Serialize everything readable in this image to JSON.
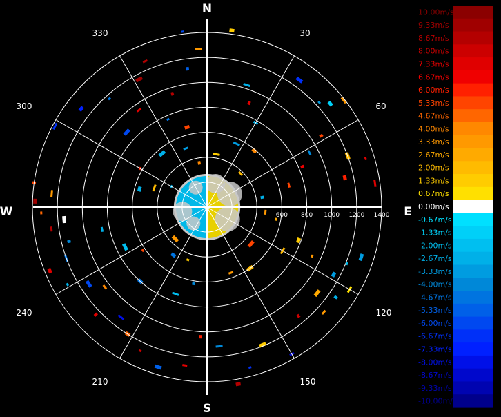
{
  "chart_data": {
    "type": "polar-ppi",
    "title": "",
    "compass_labels": [
      "N",
      "E",
      "S",
      "W"
    ],
    "bearing_labels": [
      "30",
      "60",
      "120",
      "150",
      "210",
      "240",
      "300",
      "330"
    ],
    "range_labels": [
      "600",
      "800",
      "1000",
      "1200",
      "1400"
    ],
    "range_max": 1400,
    "range_rings": [
      200,
      400,
      600,
      800,
      1000,
      1200,
      1400
    ],
    "spoke_angles_deg": [
      0,
      30,
      60,
      90,
      120,
      150,
      180,
      210,
      240,
      270,
      300,
      330
    ],
    "colorbar": {
      "unit": "m/s",
      "labels": [
        "10.00m/s",
        "9.33m/s",
        "8.67m/s",
        "8.00m/s",
        "7.33m/s",
        "6.67m/s",
        "6.00m/s",
        "5.33m/s",
        "4.67m/s",
        "4.00m/s",
        "3.33m/s",
        "2.67m/s",
        "2.00m/s",
        "1.33m/s",
        "0.67m/s",
        "0.00m/s",
        "-0.67m/s",
        "-1.33m/s",
        "-2.00m/s",
        "-2.67m/s",
        "-3.33m/s",
        "-4.00m/s",
        "-4.67m/s",
        "-5.33m/s",
        "-6.00m/s",
        "-6.67m/s",
        "-7.33m/s",
        "-8.00m/s",
        "-8.67m/s",
        "-9.33m/s",
        "-10.00m/s"
      ],
      "colors": [
        "#8b0000",
        "#a00000",
        "#b40000",
        "#cc0000",
        "#e00000",
        "#f00000",
        "#ff2000",
        "#ff4400",
        "#ff6600",
        "#ff8800",
        "#ff9900",
        "#ffaa00",
        "#ffbb00",
        "#ffcc00",
        "#ffe000",
        "#ffffff",
        "#00e0ff",
        "#00d0f8",
        "#00bff0",
        "#00b0e8",
        "#009ce0",
        "#0088d8",
        "#0074e0",
        "#0060e8",
        "#0048f0",
        "#0030f8",
        "#0020ff",
        "#0010e8",
        "#0008cc",
        "#0004b0",
        "#00008b"
      ],
      "label_colors": [
        "#8b0000",
        "#a00000",
        "#b40000",
        "#cc0000",
        "#e00000",
        "#f00000",
        "#ff2000",
        "#ff4400",
        "#ff6600",
        "#ff8800",
        "#ff9900",
        "#ffaa00",
        "#ffbb00",
        "#ffcc00",
        "#ffe000",
        "#ffffff",
        "#00e0ff",
        "#00d0f8",
        "#00bff0",
        "#00b0e8",
        "#009ce0",
        "#0088d8",
        "#0074e0",
        "#0060e8",
        "#0048f0",
        "#0030f8",
        "#0020ff",
        "#0010e8",
        "#0008cc",
        "#0004b0",
        "#00008b"
      ]
    },
    "central_region": {
      "range_max": 250,
      "west_half_color": "#00b8e8",
      "east_half_color": "#e8d000",
      "edge_color": "#c8c8c8"
    },
    "echoes": [
      {
        "az": 352,
        "r": 1420,
        "v": -6.0
      },
      {
        "az": 8,
        "r": 1430,
        "v": 1.5
      },
      {
        "az": 357,
        "r": 1270,
        "v": 3.5
      },
      {
        "az": 352,
        "r": 1120,
        "v": -5.5
      },
      {
        "az": 337,
        "r": 1270,
        "v": 8.5
      },
      {
        "az": 332,
        "r": 1160,
        "v": 9.0
      },
      {
        "az": 318,
        "r": 1170,
        "v": -5.0
      },
      {
        "az": 308,
        "r": 1280,
        "v": -7.5
      },
      {
        "az": 298,
        "r": 1380,
        "v": -7.0
      },
      {
        "az": 343,
        "r": 950,
        "v": 8.5
      },
      {
        "az": 325,
        "r": 950,
        "v": 7.5
      },
      {
        "az": 313,
        "r": 880,
        "v": -6.0
      },
      {
        "az": 336,
        "r": 770,
        "v": -4.5
      },
      {
        "az": 346,
        "r": 660,
        "v": 5.5
      },
      {
        "az": 18,
        "r": 1030,
        "v": -3.0
      },
      {
        "az": 22,
        "r": 900,
        "v": 7.0
      },
      {
        "az": 30,
        "r": 780,
        "v": -2.5
      },
      {
        "az": 36,
        "r": 1260,
        "v": -6.5
      },
      {
        "az": 47,
        "r": 1230,
        "v": -3.5
      },
      {
        "az": 50,
        "r": 1290,
        "v": -1.5
      },
      {
        "az": 52,
        "r": 1390,
        "v": 3.0
      },
      {
        "az": 58,
        "r": 1080,
        "v": 5.0
      },
      {
        "az": 62,
        "r": 930,
        "v": -4.0
      },
      {
        "az": 70,
        "r": 1200,
        "v": 2.0
      },
      {
        "az": 73,
        "r": 1330,
        "v": 7.0
      },
      {
        "az": 78,
        "r": 1130,
        "v": 6.0
      },
      {
        "az": 82,
        "r": 1360,
        "v": 7.5
      },
      {
        "az": 67,
        "r": 830,
        "v": 6.5
      },
      {
        "az": 75,
        "r": 680,
        "v": 5.0
      },
      {
        "az": 108,
        "r": 1300,
        "v": -3.5
      },
      {
        "az": 112,
        "r": 1210,
        "v": -2.0
      },
      {
        "az": 118,
        "r": 1150,
        "v": -3.5
      },
      {
        "az": 120,
        "r": 1320,
        "v": 0.8
      },
      {
        "az": 125,
        "r": 1260,
        "v": -3.0
      },
      {
        "az": 132,
        "r": 1260,
        "v": 3.5
      },
      {
        "az": 128,
        "r": 1120,
        "v": 2.5
      },
      {
        "az": 115,
        "r": 930,
        "v": 3.0
      },
      {
        "az": 110,
        "r": 780,
        "v": 1.5
      },
      {
        "az": 120,
        "r": 700,
        "v": 2.0
      },
      {
        "az": 140,
        "r": 1140,
        "v": 8.0
      },
      {
        "az": 150,
        "r": 1360,
        "v": -9.0
      },
      {
        "az": 158,
        "r": 1190,
        "v": 1.5
      },
      {
        "az": 165,
        "r": 1330,
        "v": -7.0
      },
      {
        "az": 170,
        "r": 1440,
        "v": 8.5
      },
      {
        "az": 175,
        "r": 1120,
        "v": -4.0
      },
      {
        "az": 183,
        "r": 1040,
        "v": 6.0
      },
      {
        "az": 188,
        "r": 1280,
        "v": 7.5
      },
      {
        "az": 197,
        "r": 1340,
        "v": -5.5
      },
      {
        "az": 205,
        "r": 1270,
        "v": 8.0
      },
      {
        "az": 212,
        "r": 1200,
        "v": 4.5
      },
      {
        "az": 218,
        "r": 1120,
        "v": -8.0
      },
      {
        "az": 226,
        "r": 1240,
        "v": 7.0
      },
      {
        "az": 232,
        "r": 1040,
        "v": 4.0
      },
      {
        "az": 237,
        "r": 1130,
        "v": -6.0
      },
      {
        "az": 241,
        "r": 1280,
        "v": -2.5
      },
      {
        "az": 248,
        "r": 1360,
        "v": 7.0
      },
      {
        "az": 250,
        "r": 1200,
        "v": -5.0
      },
      {
        "az": 256,
        "r": 1140,
        "v": -4.0
      },
      {
        "az": 262,
        "r": 1260,
        "v": 8.5
      },
      {
        "az": 265,
        "r": 1150,
        "v": 0.0
      },
      {
        "az": 268,
        "r": 1330,
        "v": 4.5
      },
      {
        "az": 272,
        "r": 1380,
        "v": 9.0
      },
      {
        "az": 275,
        "r": 1250,
        "v": 3.0
      },
      {
        "az": 278,
        "r": 1400,
        "v": 5.0
      },
      {
        "az": 258,
        "r": 860,
        "v": -3.0
      },
      {
        "az": 244,
        "r": 730,
        "v": -2.0
      },
      {
        "az": 236,
        "r": 620,
        "v": 5.0
      },
      {
        "az": 222,
        "r": 800,
        "v": -4.5
      },
      {
        "az": 200,
        "r": 740,
        "v": -2.0
      },
      {
        "az": 190,
        "r": 620,
        "v": -4.0
      },
      {
        "az": 160,
        "r": 560,
        "v": 3.5
      },
      {
        "az": 145,
        "r": 600,
        "v": 2.0
      },
      {
        "az": 100,
        "r": 560,
        "v": 2.5
      },
      {
        "az": 40,
        "r": 590,
        "v": 4.0
      },
      {
        "az": 25,
        "r": 560,
        "v": -3.5
      },
      {
        "az": 0,
        "r": 590,
        "v": 3.0
      },
      {
        "az": 340,
        "r": 500,
        "v": -3.5
      },
      {
        "az": 320,
        "r": 560,
        "v": -2.5
      },
      {
        "az": 300,
        "r": 620,
        "v": 6.0
      },
      {
        "az": 285,
        "r": 560,
        "v": -3.0
      },
      {
        "az": 290,
        "r": 450,
        "v": 2.0
      },
      {
        "az": 80,
        "r": 450,
        "v": -2.5
      },
      {
        "az": 95,
        "r": 470,
        "v": 3.5
      },
      {
        "az": 130,
        "r": 460,
        "v": 5.0
      },
      {
        "az": 200,
        "r": 450,
        "v": 1.5
      },
      {
        "az": 215,
        "r": 470,
        "v": -5.0
      },
      {
        "az": 10,
        "r": 430,
        "v": 1.5
      },
      {
        "az": 350,
        "r": 360,
        "v": 4.0
      },
      {
        "az": 45,
        "r": 380,
        "v": 2.0
      },
      {
        "az": 225,
        "r": 360,
        "v": 3.0
      },
      {
        "az": 300,
        "r": 330,
        "v": -3.0
      }
    ]
  }
}
